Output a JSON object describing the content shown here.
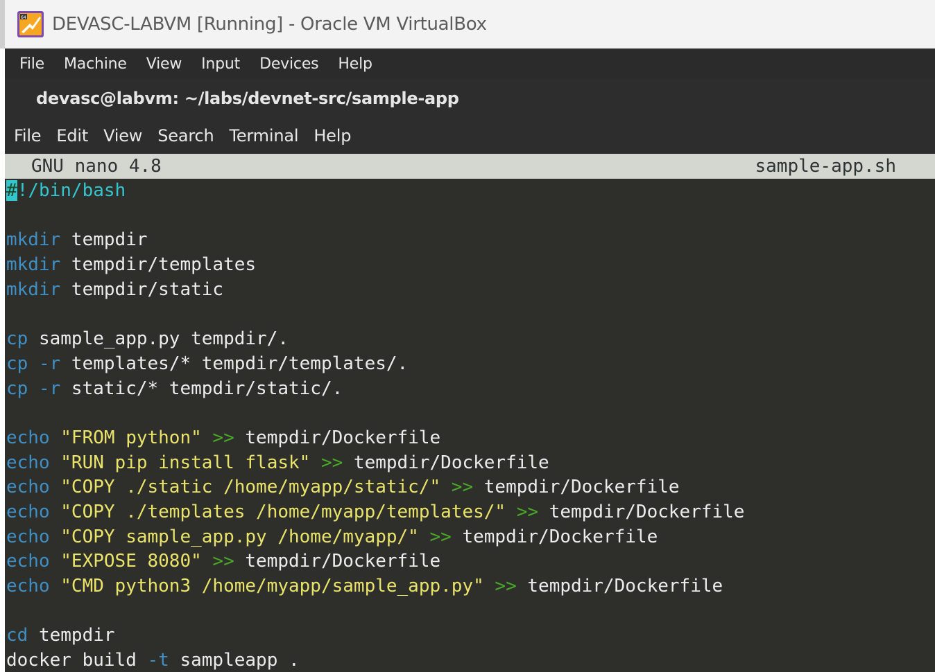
{
  "window": {
    "title": "DEVASC-LABVM [Running] - Oracle VM VirtualBox",
    "menu": [
      "File",
      "Machine",
      "View",
      "Input",
      "Devices",
      "Help"
    ]
  },
  "terminal": {
    "title": "devasc@labvm: ~/labs/devnet-src/sample-app",
    "menu": [
      "File",
      "Edit",
      "View",
      "Search",
      "Terminal",
      "Help"
    ]
  },
  "nano": {
    "version": "GNU nano 4.8",
    "filename": "sample-app.sh"
  },
  "code": {
    "l1": "/bin/bash",
    "l1_hash": "#",
    "l1_bang": "!",
    "l3_cmd": "mkdir",
    "l3_arg": " tempdir",
    "l4_cmd": "mkdir",
    "l4_arg": " tempdir/templates",
    "l5_cmd": "mkdir",
    "l5_arg": " tempdir/static",
    "l7_cmd": "cp",
    "l7_arg": " sample_app.py tempdir/.",
    "l8_cmd": "cp",
    "l8_flag": " -r",
    "l8_arg": " templates/* tempdir/templates/.",
    "l9_cmd": "cp",
    "l9_flag": " -r",
    "l9_arg": " static/* tempdir/static/.",
    "l11_cmd": "echo",
    "l11_str": " \"FROM python\"",
    "l11_redir": " >>",
    "l11_arg": " tempdir/Dockerfile",
    "l12_cmd": "echo",
    "l12_str": " \"RUN pip install flask\"",
    "l12_redir": " >>",
    "l12_arg": " tempdir/Dockerfile",
    "l13_cmd": "echo",
    "l13_str": " \"COPY ./static /home/myapp/static/\"",
    "l13_redir": " >>",
    "l13_arg": " tempdir/Dockerfile",
    "l14_cmd": "echo",
    "l14_str": " \"COPY ./templates /home/myapp/templates/\"",
    "l14_redir": " >>",
    "l14_arg": " tempdir/Dockerfile",
    "l15_cmd": "echo",
    "l15_str": " \"COPY sample_app.py /home/myapp/\"",
    "l15_redir": " >>",
    "l15_arg": " tempdir/Dockerfile",
    "l16_cmd": "echo",
    "l16_str": " \"EXPOSE 8080\"",
    "l16_redir": " >>",
    "l16_arg": " tempdir/Dockerfile",
    "l17_cmd": "echo",
    "l17_str": " \"CMD python3 /home/myapp/sample_app.py\"",
    "l17_redir": " >>",
    "l17_arg": " tempdir/Dockerfile",
    "l19_cmd": "cd",
    "l19_arg": " tempdir",
    "l20_cmd": "docker",
    "l20_arg": " build",
    "l20_flag": " -t",
    "l20_tail": " sampleapp ."
  },
  "colors": {
    "command": "#3f8fc4",
    "string": "#e9e36a",
    "redirect": "#4aa829",
    "shebang": "#34c6cf",
    "background": "#2e2e2b"
  }
}
